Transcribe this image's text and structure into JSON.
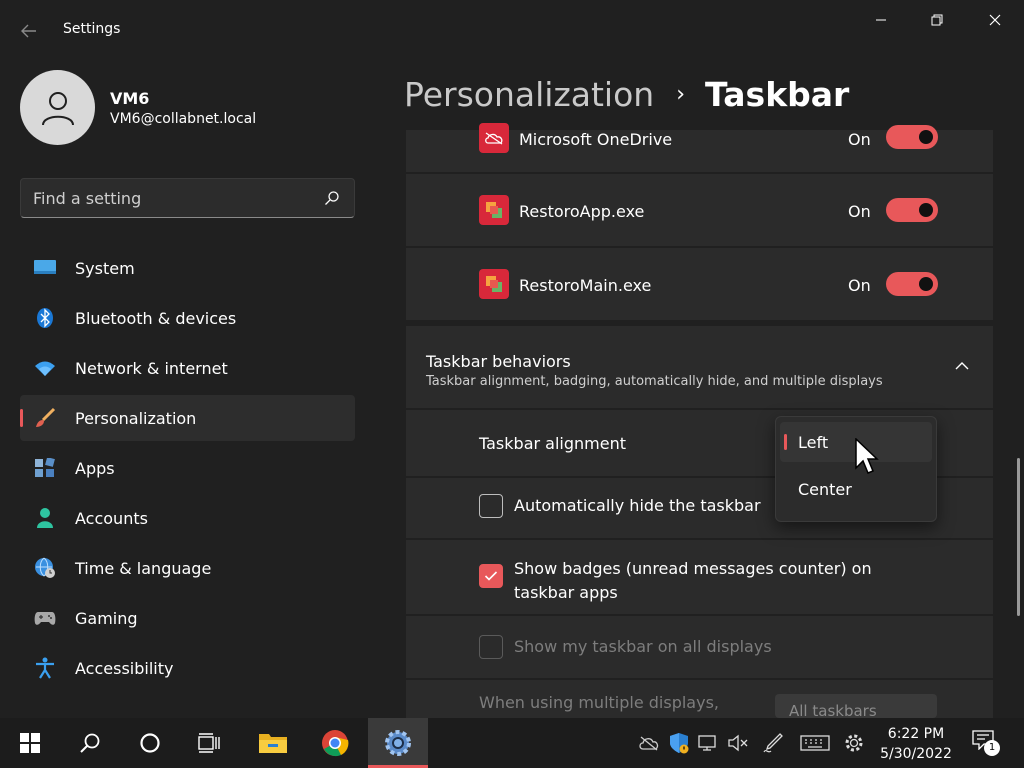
{
  "window": {
    "title": "Settings",
    "back_icon": "back-arrow-icon",
    "controls": [
      "minimize-icon",
      "restore-icon",
      "close-icon"
    ]
  },
  "account": {
    "name": "VM6",
    "email": "VM6@collabnet.local"
  },
  "search": {
    "placeholder": "Find a setting"
  },
  "sidebar": {
    "items": [
      {
        "label": "System",
        "icon": "monitor-icon",
        "active": false
      },
      {
        "label": "Bluetooth & devices",
        "icon": "bluetooth-icon",
        "active": false
      },
      {
        "label": "Network & internet",
        "icon": "wifi-icon",
        "active": false
      },
      {
        "label": "Personalization",
        "icon": "paintbrush-icon",
        "active": true
      },
      {
        "label": "Apps",
        "icon": "apps-icon",
        "active": false
      },
      {
        "label": "Accounts",
        "icon": "person-icon",
        "active": false
      },
      {
        "label": "Time & language",
        "icon": "globe-clock-icon",
        "active": false
      },
      {
        "label": "Gaming",
        "icon": "gamepad-icon",
        "active": false
      },
      {
        "label": "Accessibility",
        "icon": "accessibility-icon",
        "active": false
      }
    ]
  },
  "breadcrumb": {
    "parent": "Personalization",
    "separator": "›",
    "current": "Taskbar"
  },
  "tray_apps": [
    {
      "name": "Microsoft OneDrive",
      "state": "On",
      "enabled": true
    },
    {
      "name": "RestoroApp.exe",
      "state": "On",
      "enabled": true
    },
    {
      "name": "RestoroMain.exe",
      "state": "On",
      "enabled": true
    }
  ],
  "behaviors": {
    "title": "Taskbar behaviors",
    "subtitle": "Taskbar alignment, badging, automatically hide, and multiple displays",
    "expanded": true,
    "alignment": {
      "label": "Taskbar alignment",
      "options": [
        "Left",
        "Center"
      ],
      "selected": "Left"
    },
    "auto_hide": {
      "label": "Automatically hide the taskbar",
      "checked": false
    },
    "badges": {
      "label": "Show badges (unread messages counter) on taskbar apps",
      "checked": true
    },
    "all_displays": {
      "label": "Show my taskbar on all displays",
      "checked": false,
      "disabled": true
    },
    "multi_display": {
      "label": "When using multiple displays,",
      "value": "All taskbars",
      "disabled": true
    }
  },
  "taskbar": {
    "apps": [
      "start-icon",
      "search-icon",
      "cortana-icon",
      "task-view-icon",
      "file-explorer-icon",
      "chrome-icon",
      "settings-icon"
    ],
    "active_app": "settings-icon",
    "tray": [
      "onedrive-icon",
      "security-icon",
      "network-icon",
      "volume-muted-icon",
      "pen-icon",
      "keyboard-icon",
      "gear-icon"
    ],
    "time": "6:22 PM",
    "date": "5/30/2022",
    "notification_count": "1"
  },
  "colors": {
    "accent": "#e8585a",
    "background": "#202020",
    "card": "#2b2b2b"
  }
}
